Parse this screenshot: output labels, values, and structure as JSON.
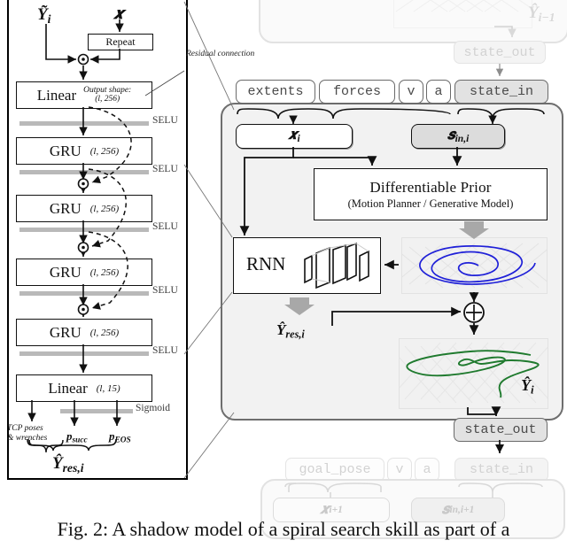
{
  "figure": {
    "caption": "Fig. 2: A shadow model of a spiral search skill as part of a"
  },
  "left_panel": {
    "title_inputs": {
      "y_tilde": "Ỹ",
      "y_tilde_sub": "i",
      "x": "𝒙"
    },
    "repeat_label": "Repeat",
    "layers": [
      {
        "name": "Linear",
        "shape": "(l, 256)",
        "shape_caption": "Output shape:",
        "activation": "SELU"
      },
      {
        "name": "GRU",
        "shape": "(l, 256)",
        "activation": "SELU"
      },
      {
        "name": "GRU",
        "shape": "(l, 256)",
        "activation": "SELU"
      },
      {
        "name": "GRU",
        "shape": "(l, 256)",
        "activation": "SELU"
      },
      {
        "name": "GRU",
        "shape": "(l, 256)",
        "activation": "SELU"
      },
      {
        "name": "Linear",
        "shape": "(l, 15)",
        "activation": "Sigmoid"
      }
    ],
    "outputs": [
      {
        "label": "TCP poses",
        "label2": "& wrenches"
      },
      {
        "label": "p",
        "sub": "succ"
      },
      {
        "label": "p",
        "sub": "EOS"
      }
    ],
    "output_group": {
      "symbol": "Ŷ",
      "sub": "res,i"
    },
    "residual_connection_label": "Residual connection"
  },
  "main_panel": {
    "input_tags": [
      {
        "text": "extents",
        "style": "white"
      },
      {
        "text": "forces",
        "style": "white"
      },
      {
        "text": "v",
        "style": "white"
      },
      {
        "text": "a",
        "style": "white"
      },
      {
        "text": "state_in",
        "style": "grey"
      }
    ],
    "vars": [
      {
        "symbol": "𝒙",
        "sub": "i",
        "style": "white"
      },
      {
        "symbol": "𝒔",
        "sub": "in,i",
        "style": "grey"
      }
    ],
    "prior": {
      "title": "Differentiable Prior",
      "subtitle": "(Motion Planner / Generative Model)"
    },
    "rnn": {
      "label": "RNN"
    },
    "residual_output": {
      "symbol": "Ŷ",
      "sub": "res,i"
    },
    "prior_plot": {
      "label": "",
      "curve_color": "#1f20d8",
      "type": "spiral"
    },
    "output_plot": {
      "label": "Ŷ",
      "sub": "i",
      "curve_color": "#1f7a2e",
      "type": "trajectory"
    },
    "sum_node": "⊕",
    "state_out_label": "state_out"
  },
  "prev_panel": {
    "state_out_label": "state_out",
    "plot_label": {
      "symbol": "Ŷ",
      "sub": "i−1"
    }
  },
  "next_panel": {
    "input_tags": [
      {
        "text": "goal_pose",
        "style": "white"
      },
      {
        "text": "v",
        "style": "white"
      },
      {
        "text": "a",
        "style": "white"
      },
      {
        "text": "state_in",
        "style": "grey"
      }
    ],
    "vars": [
      {
        "symbol": "𝒙",
        "sub": "i+1",
        "style": "white"
      },
      {
        "symbol": "𝒔",
        "sub": "in,i+1",
        "style": "grey"
      }
    ]
  },
  "colors": {
    "spiral": "#1f20d8",
    "trajectory": "#1f7a2e",
    "selu_bar": "#b9b9b9",
    "panel_bg": "#f2f2f2",
    "grey_box": "#dcdcdc"
  }
}
